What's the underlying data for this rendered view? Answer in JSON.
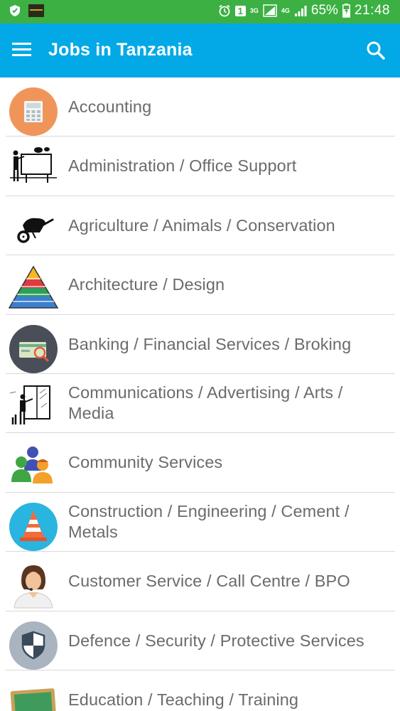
{
  "status_bar": {
    "sim": "1",
    "net1": "3G",
    "net2": "4G",
    "battery": "65%",
    "time": "21:48"
  },
  "app_bar": {
    "title": "Jobs in Tanzania",
    "menu_icon": "hamburger-menu-icon",
    "search_icon": "search-icon"
  },
  "categories": [
    {
      "label": "Accounting",
      "icon": "calculator-icon"
    },
    {
      "label": "Administration / Office Support",
      "icon": "presentation-board-icon"
    },
    {
      "label": "Agriculture / Animals / Conservation",
      "icon": "wheelbarrow-icon"
    },
    {
      "label": "Architecture / Design",
      "icon": "pyramid-icon"
    },
    {
      "label": "Banking / Financial Services / Broking",
      "icon": "bank-card-icon"
    },
    {
      "label": "Communications / Advertising / Arts / Media",
      "icon": "presenter-window-icon"
    },
    {
      "label": "Community Services",
      "icon": "people-group-icon"
    },
    {
      "label": "Construction / Engineering / Cement / Metals",
      "icon": "traffic-cone-icon"
    },
    {
      "label": "Customer Service / Call Centre / BPO",
      "icon": "call-agent-icon"
    },
    {
      "label": "Defence / Security / Protective Services",
      "icon": "shield-icon"
    },
    {
      "label": "Education / Teaching / Training",
      "icon": "chalkboard-icon"
    }
  ]
}
